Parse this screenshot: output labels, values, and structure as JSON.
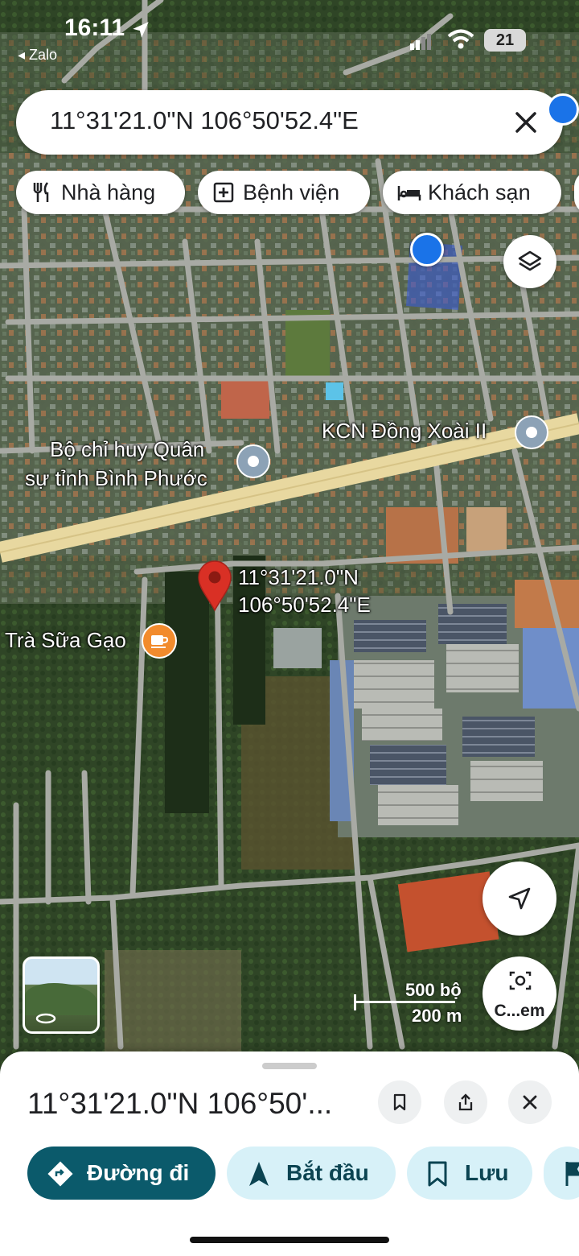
{
  "status_bar": {
    "time": "16:11",
    "back_app": "◂ Zalo",
    "battery": "21"
  },
  "search": {
    "query": "11°31'21.0\"N 106°50'52.4\"E"
  },
  "chips": [
    {
      "label": "Nhà hàng",
      "icon": "fork-knife-icon"
    },
    {
      "label": "Bệnh viện",
      "icon": "hospital-plus-icon"
    },
    {
      "label": "Khách sạn",
      "icon": "bed-icon"
    }
  ],
  "map": {
    "pin_label_line1": "11°31'21.0\"N",
    "pin_label_line2": "106°50'52.4\"E",
    "places": {
      "military_line1": "Bộ chỉ huy Quân",
      "military_line2": "sự tỉnh Bình Phước",
      "industrial": "KCN Đồng Xoài II",
      "cafe": "Trà Sữa Gạo"
    },
    "scale": {
      "imperial": "500 bộ",
      "metric": "200 m"
    },
    "camera_label": "C...em"
  },
  "sheet": {
    "title": "11°31'21.0\"N 106°50'...",
    "actions": {
      "directions": "Đường đi",
      "start": "Bắt đầu",
      "save": "Lưu"
    }
  },
  "colors": {
    "accent": "#0b5a6b",
    "chip_bg": "#d7f1f8",
    "pin": "#d93025",
    "location": "#1a73e8"
  }
}
